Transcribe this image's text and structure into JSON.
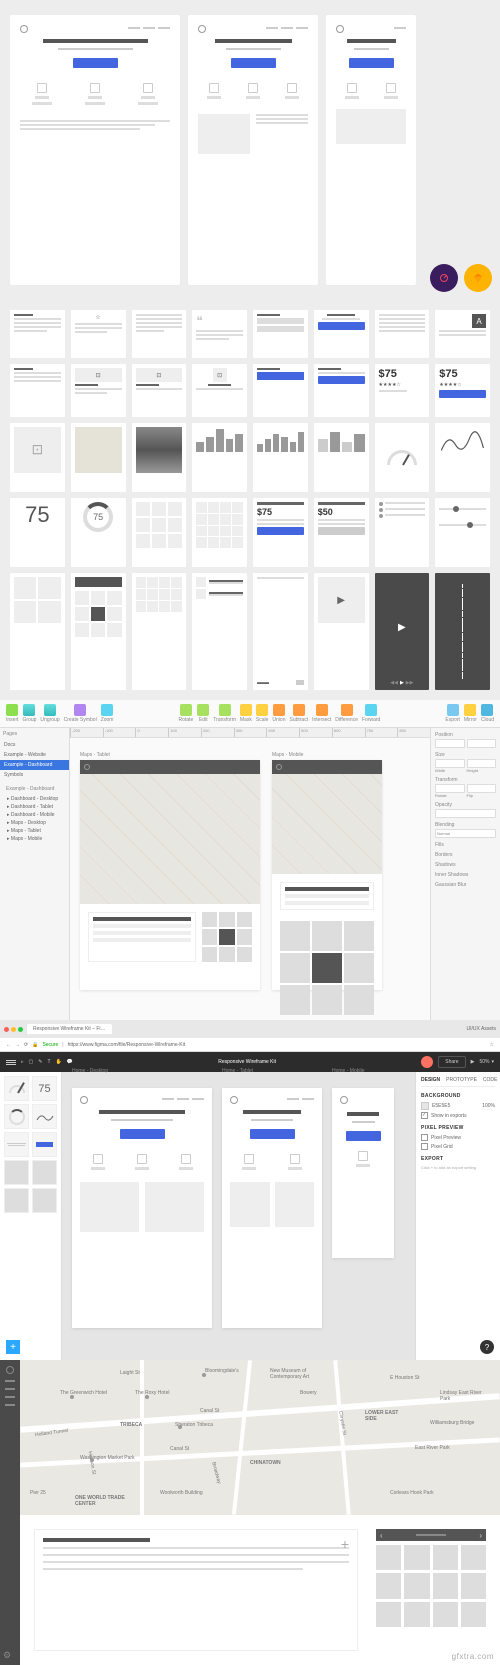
{
  "section2": {
    "price1": "$75",
    "price2": "$75",
    "bignum": "75",
    "donut_num": "75",
    "card_price1": "$75",
    "card_price2": "$50",
    "text_badge": "A"
  },
  "sketch": {
    "toolbar": [
      "Insert",
      "Group",
      "Ungroup",
      "Create Symbol",
      "Zoom",
      "Rotate",
      "Edit",
      "Transform",
      "Mask",
      "Scale",
      "Union",
      "Subtract",
      "Intersect",
      "Difference",
      "Forward",
      "Export",
      "Mirror",
      "Cloud"
    ],
    "pages_header": "Pages",
    "pages": [
      "Docs",
      "Example - Website",
      "Example - Dashboard",
      "Symbols"
    ],
    "selected_page": "Example - Dashboard",
    "layers_header": "Example - Dashboard",
    "layers": [
      "Dashboard - Desktop",
      "Dashboard - Tablet",
      "Dashboard - Mobile",
      "Maps - Desktop",
      "Maps - Tablet",
      "Maps - Mobile"
    ],
    "artboard1_label": "Maps - Tablet",
    "artboard2_label": "Maps - Mobile",
    "ruler": [
      "-200",
      "-100",
      "0",
      "100",
      "200",
      "300",
      "400",
      "500",
      "600",
      "700",
      "800"
    ],
    "props": {
      "position": "Position",
      "size": "Size",
      "size_w": "Width",
      "size_h": "Height",
      "transform": "Transform",
      "rotate": "Rotate",
      "flip": "Flip",
      "opacity": "Opacity",
      "blending": "Blending",
      "blending_val": "Normal",
      "fills": "Fills",
      "borders": "Borders",
      "shadows": "Shadows",
      "inner_shadows": "Inner Shadows",
      "blur": "Gaussian Blur"
    }
  },
  "figma": {
    "tab_title": "Responsive Wireframe Kit – Fi…",
    "right_label": "UI/UX Assets",
    "url_secure": "Secure",
    "url": "https://www.figma.com/file/Responsive-Wireframe-Kit",
    "doc_title": "Responsive Wireframe Kit",
    "zoom": "50%",
    "artboard_labels": [
      "Home - Desktop",
      "Home - Tablet",
      "Home - Mobile"
    ],
    "left_bignum": "75",
    "panel": {
      "tabs": [
        "DESIGN",
        "PROTOTYPE",
        "CODE"
      ],
      "bg_header": "BACKGROUND",
      "bg_value": "E5E5E5",
      "bg_pct": "100%",
      "show_exports": "Show in exports",
      "pp_header": "PIXEL PREVIEW",
      "pixel_preview": "Pixel Preview",
      "pixel_grid": "Pixel Grid",
      "export_header": "EXPORT",
      "export_hint": "Click + to add an export setting"
    }
  },
  "map": {
    "labels": [
      "Laight St",
      "Canal St",
      "Bowery",
      "Canal St",
      "E Houston St",
      "Holland Tunnel",
      "Hudson St",
      "Broadway",
      "Chrystie St",
      "Pier 25"
    ],
    "places": [
      "Bloomingdale's",
      "New Museum of Contemporary Art",
      "The Greenwich Hotel",
      "The Roxy Hotel",
      "TRIBECA",
      "Sheraton Tribeca",
      "LOWER EAST SIDE",
      "Washington Market Park",
      "CHINATOWN",
      "East River Park",
      "Williamsburg Bridge",
      "ONE WORLD TRADE CENTER",
      "Corlears Hook Park",
      "Lindsay East River Park",
      "Woolworth Building"
    ]
  },
  "watermark": "gfxtra.com"
}
